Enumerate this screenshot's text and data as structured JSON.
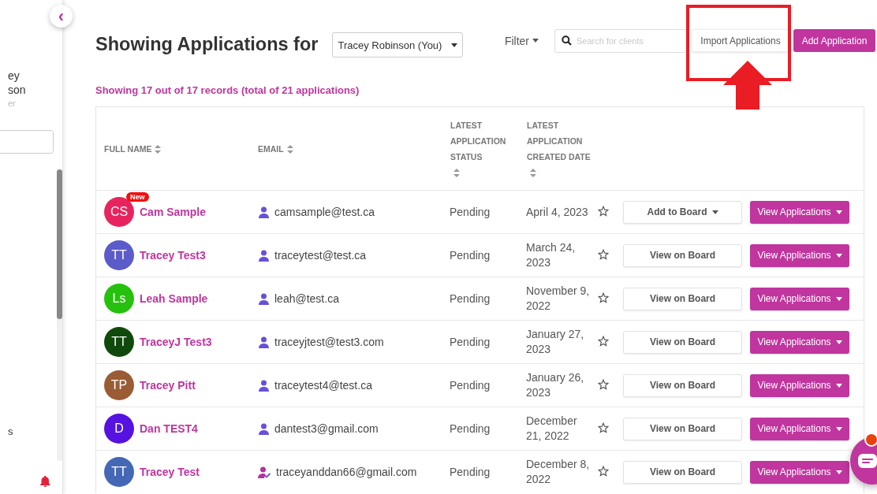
{
  "sidebar": {
    "user_name_lines": [
      "ey",
      "son"
    ],
    "user_role": "er",
    "menu_item": "s",
    "collapse_button": {
      "icon": "‹"
    }
  },
  "header": {
    "title": "Showing Applications for",
    "user_select": "Tracey Robinson (You)",
    "filter": "Filter",
    "search": {
      "placeholder": "Search for clients"
    },
    "buttons": [
      {
        "label": "Import Applications",
        "kind": "secondary",
        "highlighted": true
      },
      {
        "label": "Add Application",
        "kind": "primary",
        "highlighted": false
      }
    ]
  },
  "summary": "Showing 17 out of 17 records (total of 21 applications)",
  "table": {
    "columns": [
      "FULL NAME",
      "EMAIL",
      "LATEST APPLICATION STATUS",
      "LATEST APPLICATION CREATED DATE"
    ],
    "rows": [
      {
        "initials": "CS",
        "color": "#e8245e",
        "badge": "New",
        "name": "Cam Sample",
        "email": {
          "kind": "person",
          "text": "camsample@test.ca"
        },
        "status": "Pending",
        "date": "April 4, 2023",
        "starred": false,
        "board_action": {
          "label": "Add to Board",
          "kind": "dropdown"
        },
        "view": "View Applications"
      },
      {
        "initials": "TT",
        "color": "#5b5bc9",
        "name": "Tracey Test3",
        "email": {
          "kind": "person",
          "text": "traceytest@test.ca"
        },
        "status": "Pending",
        "date": "March 24, 2023",
        "starred": false,
        "board_action": {
          "label": "View on Board",
          "kind": "plain"
        },
        "view": "View Applications"
      },
      {
        "initials": "Ls",
        "color": "#26c10e",
        "name": "Leah Sample",
        "email": {
          "kind": "person",
          "text": "leah@test.ca"
        },
        "status": "Pending",
        "date": "November 9, 2022",
        "starred": false,
        "board_action": {
          "label": "View on Board",
          "kind": "plain"
        },
        "view": "View Applications"
      },
      {
        "initials": "TT",
        "color": "#0f4a0c",
        "name": "TraceyJ Test3",
        "email": {
          "kind": "person",
          "text": "traceyjtest@test3.com"
        },
        "status": "Pending",
        "date": "January 27, 2023",
        "starred": false,
        "board_action": {
          "label": "View on Board",
          "kind": "plain"
        },
        "view": "View Applications"
      },
      {
        "initials": "TP",
        "color": "#9a5c34",
        "name": "Tracey Pitt",
        "email": {
          "kind": "person",
          "text": "traceytest4@test.ca"
        },
        "status": "Pending",
        "date": "January 26, 2023",
        "starred": false,
        "board_action": {
          "label": "View on Board",
          "kind": "plain"
        },
        "view": "View Applications"
      },
      {
        "initials": "D",
        "color": "#5512e0",
        "name": "Dan TEST4",
        "email": {
          "kind": "person",
          "text": "dantest3@gmail.com"
        },
        "status": "Pending",
        "date": "December 21, 2022",
        "starred": false,
        "board_action": {
          "label": "View on Board",
          "kind": "plain"
        },
        "view": "View Applications"
      },
      {
        "initials": "TT",
        "color": "#4468b5",
        "name": "Tracey Test",
        "email": {
          "kind": "verified",
          "text": "traceyanddan66@gmail.com"
        },
        "status": "Pending",
        "date": "December 8, 2022",
        "starred": false,
        "board_action": {
          "label": "View on Board",
          "kind": "plain"
        },
        "view": "View Applications"
      }
    ]
  },
  "chat": {
    "unread": true
  }
}
